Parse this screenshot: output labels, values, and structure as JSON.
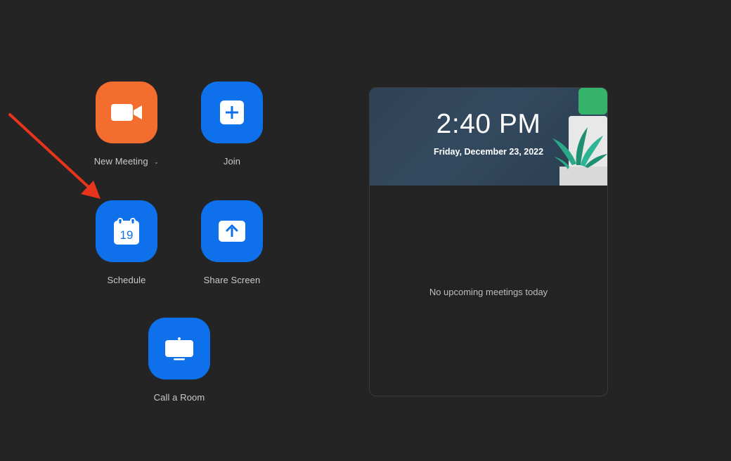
{
  "actions": {
    "new_meeting": {
      "label": "New Meeting",
      "icon": "video-camera-icon",
      "color": "#f26d2e"
    },
    "join": {
      "label": "Join",
      "icon": "plus-icon",
      "color": "#0e71eb"
    },
    "schedule": {
      "label": "Schedule",
      "icon": "calendar-icon",
      "day": "19",
      "color": "#0e71eb"
    },
    "share_screen": {
      "label": "Share Screen",
      "icon": "upload-arrow-icon",
      "color": "#0e71eb"
    },
    "call_room": {
      "label": "Call a Room",
      "icon": "monitor-icon",
      "color": "#0e71eb"
    }
  },
  "panel": {
    "time": "2:40 PM",
    "date": "Friday, December 23, 2022",
    "empty_message": "No upcoming meetings today"
  },
  "annotation": {
    "type": "arrow",
    "color": "#e8341c",
    "points_to": "schedule"
  }
}
